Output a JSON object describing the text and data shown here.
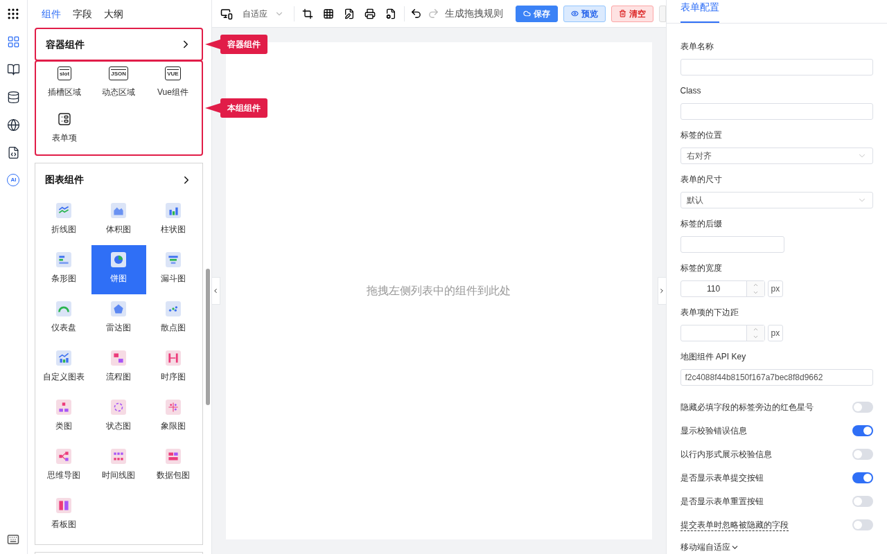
{
  "rail": {
    "items": [
      {
        "kind": "grid",
        "selected": true
      },
      {
        "kind": "book",
        "selected": false
      },
      {
        "kind": "database",
        "selected": false
      },
      {
        "kind": "globe",
        "selected": false
      },
      {
        "kind": "code",
        "selected": false
      },
      {
        "kind": "ai",
        "selected": false,
        "label": "AI"
      }
    ]
  },
  "panel_tabs": [
    {
      "label": "组件",
      "selected": true
    },
    {
      "label": "字段",
      "selected": false
    },
    {
      "label": "大纲",
      "selected": false
    }
  ],
  "groups": [
    {
      "title": "容器组件",
      "items": [
        {
          "label": "插槽区域",
          "icon_text": "slot",
          "selected": false
        },
        {
          "label": "动态区域",
          "icon_text": "JSON",
          "selected": false
        },
        {
          "label": "Vue组件",
          "icon_text": "VUE",
          "selected": false
        },
        {
          "label": "表单项",
          "selected": false
        }
      ]
    },
    {
      "title": "图表组件",
      "items": [
        {
          "label": "折线图",
          "selected": false
        },
        {
          "label": "体积图",
          "selected": false
        },
        {
          "label": "柱状图",
          "selected": false
        },
        {
          "label": "条形图",
          "selected": false
        },
        {
          "label": "饼图",
          "selected": true
        },
        {
          "label": "漏斗图",
          "selected": false
        },
        {
          "label": "仪表盘",
          "selected": false
        },
        {
          "label": "雷达图",
          "selected": false
        },
        {
          "label": "散点图",
          "selected": false
        },
        {
          "label": "自定义图表",
          "selected": false
        },
        {
          "label": "流程图",
          "selected": false
        },
        {
          "label": "时序图",
          "selected": false
        },
        {
          "label": "类图",
          "selected": false
        },
        {
          "label": "状态图",
          "selected": false
        },
        {
          "label": "象限图",
          "selected": false
        },
        {
          "label": "思维导图",
          "selected": false
        },
        {
          "label": "时间线图",
          "selected": false
        },
        {
          "label": "数据包图",
          "selected": false
        },
        {
          "label": "看板图",
          "selected": false
        }
      ]
    }
  ],
  "callouts": [
    "容器组件",
    "本组组件"
  ],
  "toolbar": {
    "layout_select": "自适应",
    "generate": "生成拖拽规则",
    "buttons": [
      {
        "kind": "primary",
        "label": "保存"
      },
      {
        "kind": "info",
        "label": "预览"
      },
      {
        "kind": "danger",
        "label": "清空"
      }
    ]
  },
  "canvas": {
    "hint": "拖拽左侧列表中的组件到此处"
  },
  "config": {
    "tab": "表单配置",
    "fields": [
      {
        "kind": "input",
        "label": "表单名称"
      },
      {
        "kind": "input",
        "label": "Class"
      },
      {
        "kind": "select",
        "label": "标签的位置",
        "value": "右对齐"
      },
      {
        "kind": "select",
        "label": "表单的尺寸",
        "value": "默认"
      },
      {
        "kind": "short",
        "label": "标签的后缀"
      },
      {
        "kind": "number",
        "label": "标签的宽度",
        "value": "110",
        "unit": "px"
      },
      {
        "kind": "number",
        "label": "表单项的下边距",
        "unit": "px"
      },
      {
        "kind": "input",
        "label": "地图组件 API Key",
        "value": "f2c4088f44b8150f167a7bec8f8d9662"
      },
      {
        "kind": "switch",
        "label": "隐藏必填字段的标签旁边的红色星号",
        "on": false,
        "hint": false
      },
      {
        "kind": "switch",
        "label": "显示校验错误信息",
        "on": true,
        "hint": false
      },
      {
        "kind": "switch",
        "label": "以行内形式展示校验信息",
        "on": false,
        "hint": false
      },
      {
        "kind": "switch",
        "label": "是否显示表单提交按钮",
        "on": true,
        "hint": false
      },
      {
        "kind": "switch",
        "label": "是否显示表单重置按钮",
        "on": false,
        "hint": false
      },
      {
        "kind": "switch",
        "label": "提交表单时忽略被隐藏的字段",
        "on": false,
        "hint": true
      },
      {
        "kind": "expander",
        "label": "移动端自适应"
      }
    ]
  }
}
